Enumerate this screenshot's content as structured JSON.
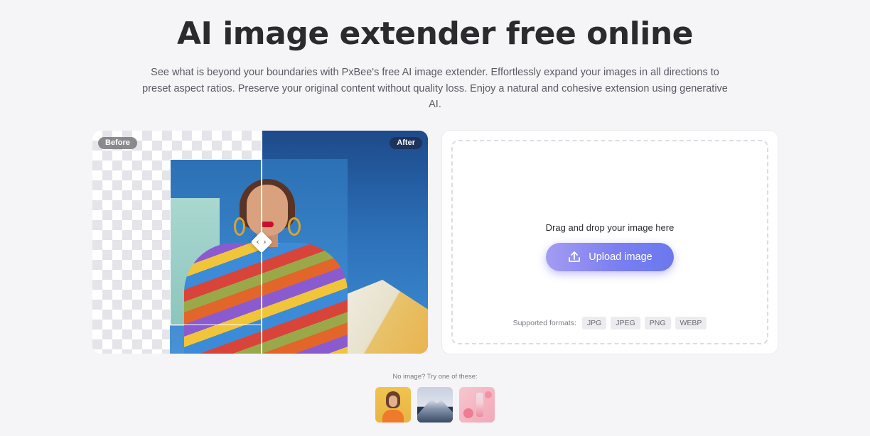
{
  "hero": {
    "title": "AI image extender free online",
    "subtitle": "See what is beyond your boundaries with PxBee's free AI image extender. Effortlessly expand your images in all directions to preset aspect ratios. Preserve your original content without quality loss. Enjoy a natural and cohesive extension using generative AI."
  },
  "compare": {
    "before_label": "Before",
    "after_label": "After",
    "handle_glyph": "‹ ›"
  },
  "upload": {
    "drop_text": "Drag and drop your image here",
    "button_label": "Upload image",
    "formats_label": "Supported formats:",
    "formats": [
      "JPG",
      "JPEG",
      "PNG",
      "WEBP"
    ]
  },
  "samples": {
    "label": "No image? Try one of these:",
    "items": [
      "portrait-sample",
      "mountain-sample",
      "cosmetics-sample"
    ]
  },
  "colors": {
    "background": "#f5f4f7",
    "accent": "#7b7ff1",
    "title": "#2b2b2f"
  }
}
